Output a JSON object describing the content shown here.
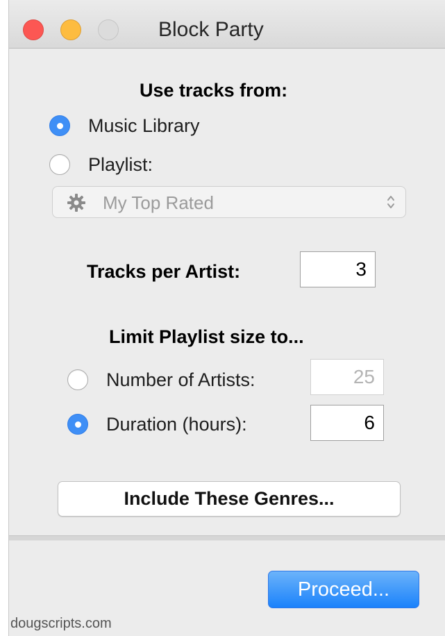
{
  "window": {
    "title": "Block Party"
  },
  "source": {
    "heading": "Use tracks from:",
    "options": [
      {
        "label": "Music Library",
        "selected": true
      },
      {
        "label": "Playlist:",
        "selected": false
      }
    ],
    "playlist_popup": {
      "value": "My Top Rated",
      "icon": "gear-icon",
      "enabled": false
    }
  },
  "tracks_per_artist": {
    "label": "Tracks per Artist:",
    "value": "3"
  },
  "limit": {
    "heading": "Limit Playlist size to...",
    "options": [
      {
        "label": "Number of Artists:",
        "value": "25",
        "selected": false,
        "enabled": false
      },
      {
        "label": "Duration (hours):",
        "value": "6",
        "selected": true,
        "enabled": true
      }
    ]
  },
  "genres_button": {
    "label": "Include These Genres..."
  },
  "proceed_button": {
    "label": "Proceed..."
  },
  "footer": {
    "text": "dougscripts.com"
  },
  "colors": {
    "accent": "#3f8ff6",
    "close": "#fc5753",
    "minimize": "#fdbc40",
    "zoom_disabled": "#dcdcdc"
  }
}
